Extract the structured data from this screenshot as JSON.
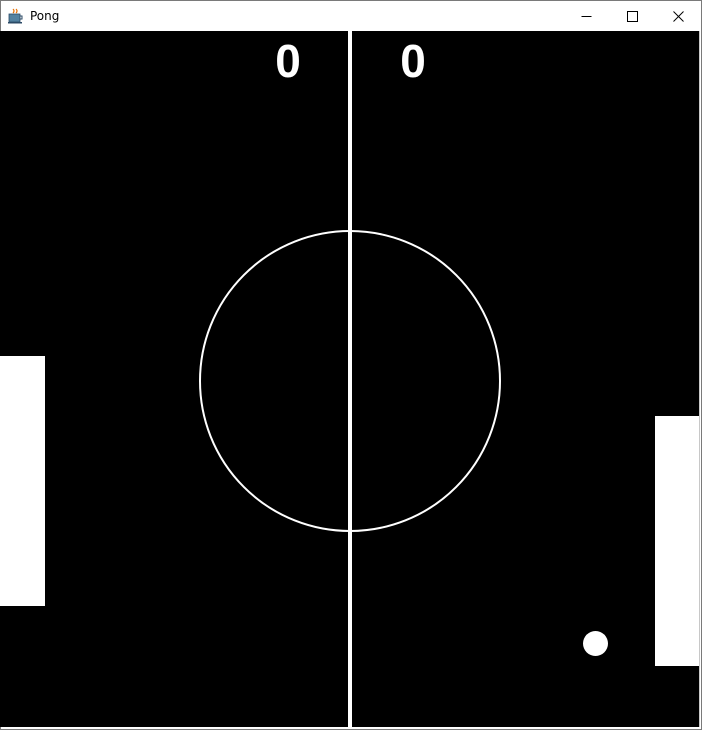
{
  "window": {
    "title": "Pong",
    "icon": "java-coffee-cup-icon",
    "controls": [
      "minimize-icon",
      "maximize-icon",
      "close-icon"
    ]
  },
  "game": {
    "score_left": "0",
    "score_right": "0",
    "colors": {
      "background": "#000000",
      "foreground": "#ffffff"
    }
  }
}
